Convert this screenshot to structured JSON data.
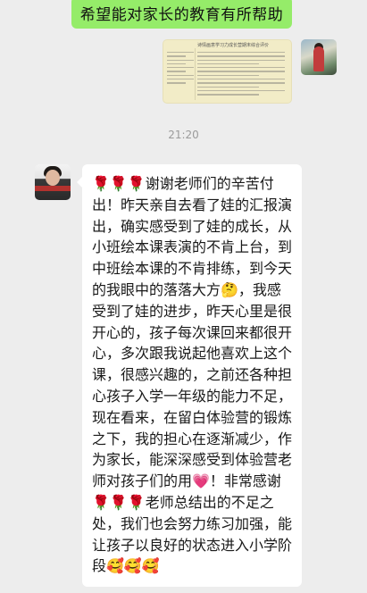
{
  "top_message": {
    "text": "希望能对家长的教育有所帮助"
  },
  "image_message": {
    "caption": "诗情画意学习力成长营期末综合评价",
    "alt": "report image"
  },
  "timestamp": "21:20",
  "incoming_message": {
    "text": "🌹🌹🌹谢谢老师们的辛苦付出！昨天亲自去看了娃的汇报演出，确实感受到了娃的成长，从小班绘本课表演的不肯上台，到中班绘本课的不肯排练，到今天的我眼中的落落大方🤔，我感受到了娃的进步，昨天心里是很开心的，孩子每次课回来都很开心，多次跟我说起他喜欢上这个课，很感兴趣的，之前还各种担心孩子入学一年级的能力不足，现在看来，在留白体验营的锻炼之下，我的担心在逐渐减少，作为家长，能深深感受到体验营老师对孩子们的用💗！非常感谢🌹🌹🌹老师总结出的不足之处，我们也会努力练习加强，能让孩子以良好的状态进入小学阶段🥰🥰🥰"
  },
  "colors": {
    "chat_bg": "#ededed",
    "self_bubble": "#95ec69",
    "other_bubble": "#ffffff",
    "timestamp": "#9b9b9b"
  },
  "icons": {
    "self_avatar": "user-avatar-photo",
    "other_avatar": "contact-avatar-photo"
  }
}
